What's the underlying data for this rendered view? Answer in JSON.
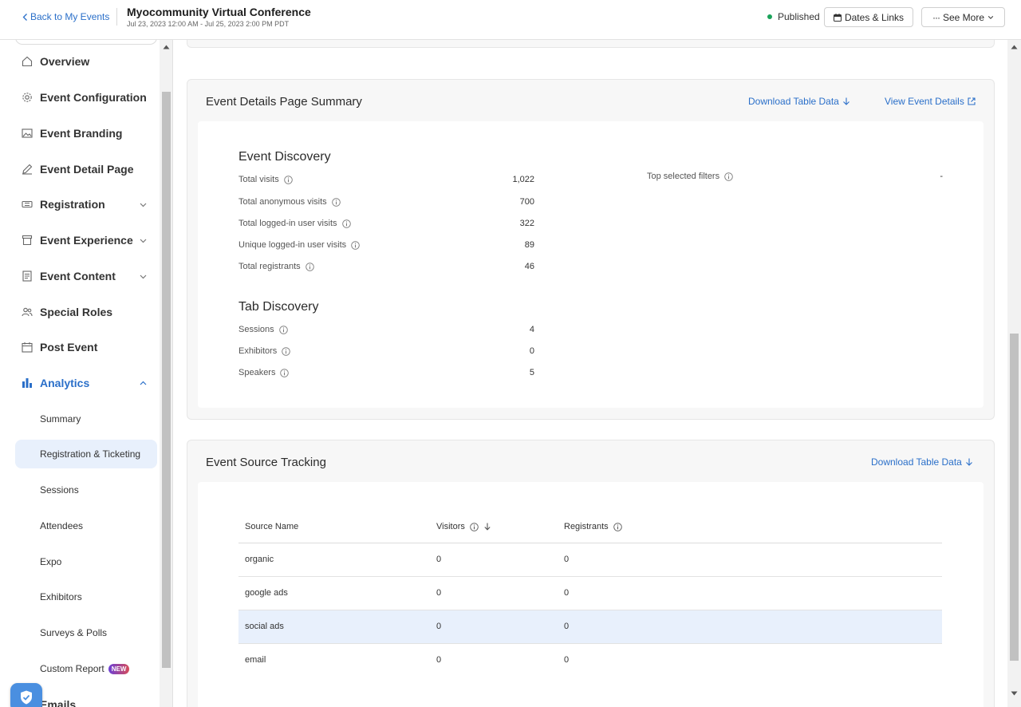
{
  "header": {
    "back_label": "Back to My Events",
    "event_title": "Myocommunity Virtual Conference",
    "event_dates": "Jul 23, 2023 12:00 AM - Jul 25, 2023 2:00 PM PDT",
    "status_label": "Published",
    "dates_links_label": "Dates & Links",
    "see_more_label": "See More"
  },
  "sidebar": {
    "items": [
      {
        "label": "Overview",
        "icon": "home-icon"
      },
      {
        "label": "Event Configuration",
        "icon": "gear-icon"
      },
      {
        "label": "Event Branding",
        "icon": "image-icon"
      },
      {
        "label": "Event Detail Page",
        "icon": "pencil-icon"
      },
      {
        "label": "Registration",
        "icon": "ticket-icon"
      },
      {
        "label": "Event Experience",
        "icon": "stage-icon"
      },
      {
        "label": "Event Content",
        "icon": "document-icon"
      },
      {
        "label": "Special Roles",
        "icon": "people-icon"
      },
      {
        "label": "Post Event",
        "icon": "calendar-icon"
      },
      {
        "label": "Analytics",
        "icon": "bar-chart-icon"
      }
    ],
    "analytics_sub": [
      {
        "label": "Summary"
      },
      {
        "label": "Registration & Ticketing"
      },
      {
        "label": "Sessions"
      },
      {
        "label": "Attendees"
      },
      {
        "label": "Expo"
      },
      {
        "label": "Exhibitors"
      },
      {
        "label": "Surveys & Polls"
      },
      {
        "label": "Custom Report",
        "badge": "NEW"
      }
    ],
    "cut_item": "Emails"
  },
  "details_summary": {
    "title": "Event Details Page Summary",
    "download_label": "Download Table Data",
    "view_label": "View Event Details",
    "event_discovery": {
      "heading": "Event Discovery",
      "rows": [
        {
          "label": "Total visits",
          "value": "1,022"
        },
        {
          "label": "Total anonymous visits",
          "value": "700"
        },
        {
          "label": "Total logged-in user visits",
          "value": "322"
        },
        {
          "label": "Unique logged-in user visits",
          "value": "89"
        },
        {
          "label": "Total registrants",
          "value": "46"
        }
      ]
    },
    "top_filters": {
      "label": "Top selected filters",
      "value": "-"
    },
    "tab_discovery": {
      "heading": "Tab Discovery",
      "rows": [
        {
          "label": "Sessions",
          "value": "4"
        },
        {
          "label": "Exhibitors",
          "value": "0"
        },
        {
          "label": "Speakers",
          "value": "5"
        }
      ]
    }
  },
  "source_tracking": {
    "title": "Event Source Tracking",
    "download_label": "Download Table Data",
    "columns": [
      "Source Name",
      "Visitors",
      "Registrants"
    ],
    "rows": [
      {
        "source": "organic",
        "visitors": "0",
        "registrants": "0"
      },
      {
        "source": "google ads",
        "visitors": "0",
        "registrants": "0"
      },
      {
        "source": "social ads",
        "visitors": "0",
        "registrants": "0"
      },
      {
        "source": "email",
        "visitors": "0",
        "registrants": "0"
      }
    ]
  },
  "colors": {
    "accent": "#2a6fc9",
    "status_green": "#1aa35a",
    "selected_bg": "#e8f0fc"
  }
}
